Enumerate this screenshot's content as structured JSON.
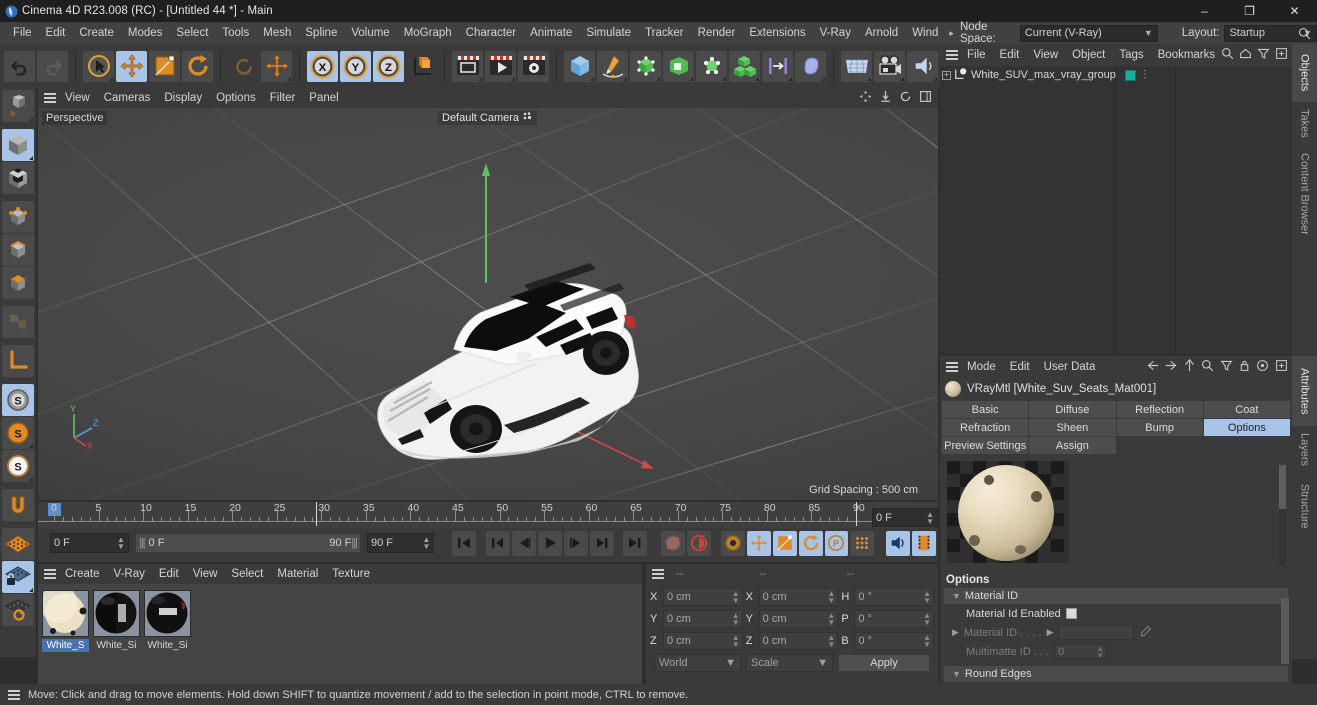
{
  "titlebar": {
    "title": "Cinema 4D R23.008 (RC) - [Untitled 44 *] - Main",
    "minimize": "–",
    "maximize": "❐",
    "close": "✕"
  },
  "menubar": {
    "items": [
      "File",
      "Edit",
      "Create",
      "Modes",
      "Select",
      "Tools",
      "Mesh",
      "Spline",
      "Volume",
      "MoGraph",
      "Character",
      "Animate",
      "Simulate",
      "Tracker",
      "Render",
      "Extensions",
      "V-Ray",
      "Arnold",
      "Wind"
    ],
    "overflow_arrow": "▸",
    "node_space_label": "Node Space:",
    "node_space_value": "Current (V-Ray)",
    "layout_label": "Layout:",
    "layout_value": "Startup"
  },
  "viewport": {
    "menu": [
      "View",
      "Cameras",
      "Display",
      "Options",
      "Filter",
      "Panel"
    ],
    "perspective_label": "Perspective",
    "camera_label": "Default Camera",
    "grid_spacing": "Grid Spacing : 500 cm",
    "axis_x": "X",
    "axis_y": "Y",
    "axis_z": "Z"
  },
  "timeline": {
    "ticks": [
      "0",
      "5",
      "10",
      "15",
      "20",
      "25",
      "30",
      "35",
      "40",
      "45",
      "50",
      "55",
      "60",
      "65",
      "70",
      "75",
      "80",
      "85",
      "90"
    ],
    "current_frame_right": "0 F",
    "current_frame_left": "0 F",
    "range_start": "0 F",
    "range_end": "90 F",
    "end_frame": "90 F"
  },
  "materials": {
    "menu": [
      "Create",
      "V-Ray",
      "Edit",
      "View",
      "Select",
      "Material",
      "Texture"
    ],
    "items": [
      {
        "name": "White_S",
        "selected": true
      },
      {
        "name": "White_Si",
        "selected": false
      },
      {
        "name": "White_Si",
        "selected": false
      }
    ]
  },
  "coordinates": {
    "header_cols": [
      "--",
      "--",
      "--"
    ],
    "rows": [
      {
        "pos_label": "X",
        "pos_value": "0 cm",
        "size_label": "X",
        "size_value": "0 cm",
        "rot_label": "H",
        "rot_value": "0 °"
      },
      {
        "pos_label": "Y",
        "pos_value": "0 cm",
        "size_label": "Y",
        "size_value": "0 cm",
        "rot_label": "P",
        "rot_value": "0 °"
      },
      {
        "pos_label": "Z",
        "pos_value": "0 cm",
        "size_label": "Z",
        "size_value": "0 cm",
        "rot_label": "B",
        "rot_value": "0 °"
      }
    ],
    "coord_system": "World",
    "mode": "Scale",
    "apply": "Apply"
  },
  "object_manager": {
    "menu": [
      "File",
      "Edit",
      "View",
      "Object",
      "Tags",
      "Bookmarks"
    ],
    "items": [
      {
        "name": "White_SUV_max_vray_group"
      }
    ]
  },
  "attribute_manager": {
    "menu": [
      "Mode",
      "Edit",
      "User Data"
    ],
    "title": "VRayMtl [White_Suv_Seats_Mat001]",
    "tabs_row1": [
      "Basic",
      "Diffuse",
      "Reflection",
      "Coat"
    ],
    "tabs_row2": [
      "Refraction",
      "Sheen",
      "Bump",
      "Options"
    ],
    "tabs_row3": [
      "Preview Settings",
      "Assign"
    ],
    "active_tab": "Options",
    "section_title": "Options",
    "groups": [
      {
        "name": "Material ID",
        "props": [
          {
            "label": "Material Id Enabled",
            "type": "checkbox",
            "checked": false
          },
          {
            "label": "Material ID . . . .",
            "type": "color",
            "value": "",
            "dim": true
          },
          {
            "label": "Multimatte ID . . .",
            "type": "number",
            "value": "0",
            "dim": true
          }
        ]
      },
      {
        "name": "Round Edges",
        "props": []
      }
    ]
  },
  "vertical_tabs_top": [
    "Objects",
    "Takes",
    "Content Browser"
  ],
  "vertical_tabs_bottom": [
    "Attributes",
    "Layers",
    "Structure"
  ],
  "statusbar": {
    "text": "Move: Click and drag to move elements. Hold down SHIFT to quantize movement / add to the selection in point mode, CTRL to remove."
  },
  "colors": {
    "accent_blue": "#a8c4e8",
    "orange": "#e08b2a",
    "teal_tag": "#19b0a0",
    "panel_bg": "#3a3a3a",
    "dark_bg": "#2a2a2a"
  }
}
